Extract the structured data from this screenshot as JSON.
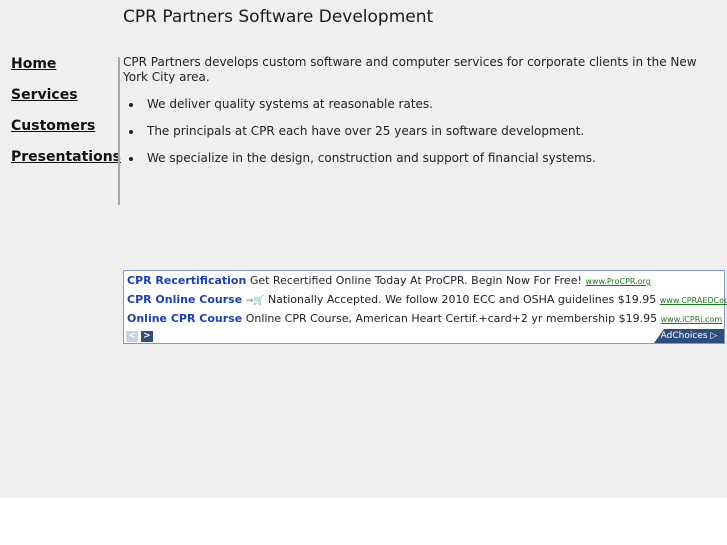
{
  "header": {
    "title": "CPR Partners Software Development"
  },
  "nav": {
    "items": [
      {
        "label": "Home"
      },
      {
        "label": "Services"
      },
      {
        "label": "Customers"
      },
      {
        "label": "Presentations"
      }
    ]
  },
  "content": {
    "intro": "CPR Partners develops custom software and computer services for corporate clients in the New York City area.",
    "bullets": [
      "We deliver quality systems at reasonable rates.",
      "The principals at CPR each have over 25 years in software development.",
      "We specialize in the design, construction and support of financial systems."
    ]
  },
  "ads": {
    "items": [
      {
        "title": "CPR Recertification",
        "text": "Get Recertified Online Today At ProCPR. Begin Now For Free!",
        "url": "www.ProCPR.org"
      },
      {
        "title": "CPR Online Course",
        "text": "Nationally Accepted. We follow 2010 ECC and OSHA guidelines $19.95",
        "url": "www.CPRAEDCourse"
      },
      {
        "title": "Online CPR Course",
        "text": "Online CPR Course, American Heart Certif.+card+2 yr membership $19.95",
        "url": "www.iCPRi.com"
      }
    ],
    "prev_glyph": "<",
    "next_glyph": ">",
    "adchoices_label": "AdChoices ▷",
    "cart_glyph": "⇝🛒"
  }
}
